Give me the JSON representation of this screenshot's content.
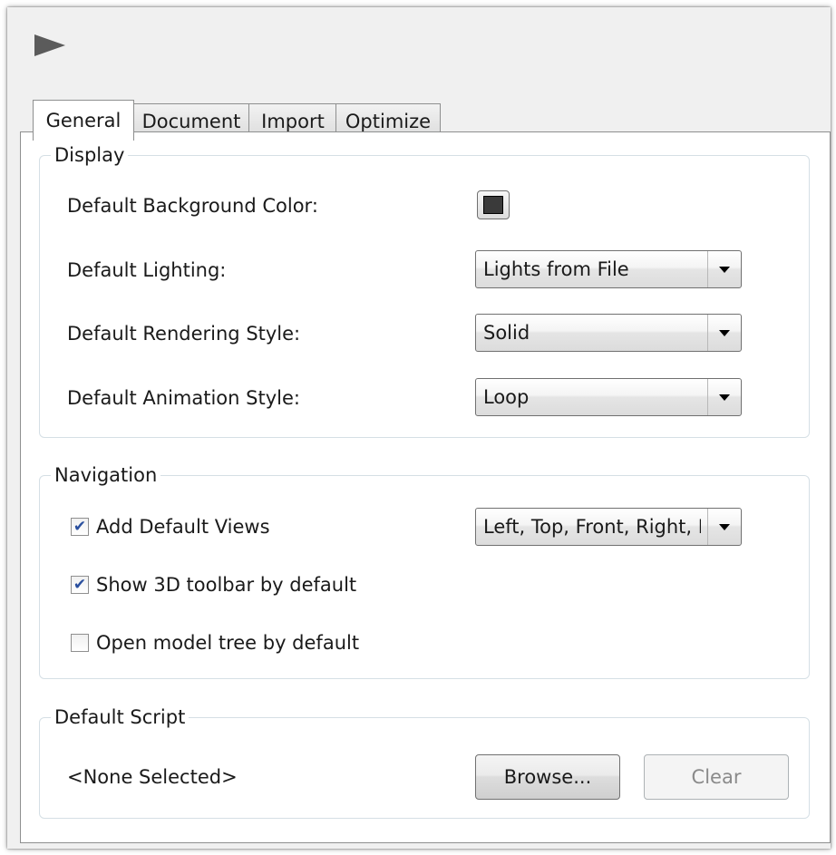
{
  "tabs": [
    {
      "label": "General",
      "active": true
    },
    {
      "label": "Document",
      "active": false
    },
    {
      "label": "Import",
      "active": false
    },
    {
      "label": "Optimize",
      "active": false
    }
  ],
  "display": {
    "title": "Display",
    "background_color": {
      "label": "Default Background Color:",
      "value": "#3a3a3a"
    },
    "lighting": {
      "label": "Default Lighting:",
      "value": "Lights from File"
    },
    "rendering": {
      "label": "Default Rendering Style:",
      "value": "Solid"
    },
    "animation": {
      "label": "Default Animation Style:",
      "value": "Loop"
    }
  },
  "navigation": {
    "title": "Navigation",
    "default_views": {
      "label": "Add Default Views",
      "checked": true,
      "value": "Left, Top, Front, Right, Bottom"
    },
    "show_toolbar": {
      "label": "Show 3D toolbar by default",
      "checked": true
    },
    "model_tree": {
      "label": "Open model tree by default",
      "checked": false
    }
  },
  "script": {
    "title": "Default Script",
    "value": "<None Selected>",
    "browse_label": "Browse...",
    "clear_label": "Clear"
  },
  "icons": {
    "header": "play-triangle-icon",
    "check": "✔"
  }
}
